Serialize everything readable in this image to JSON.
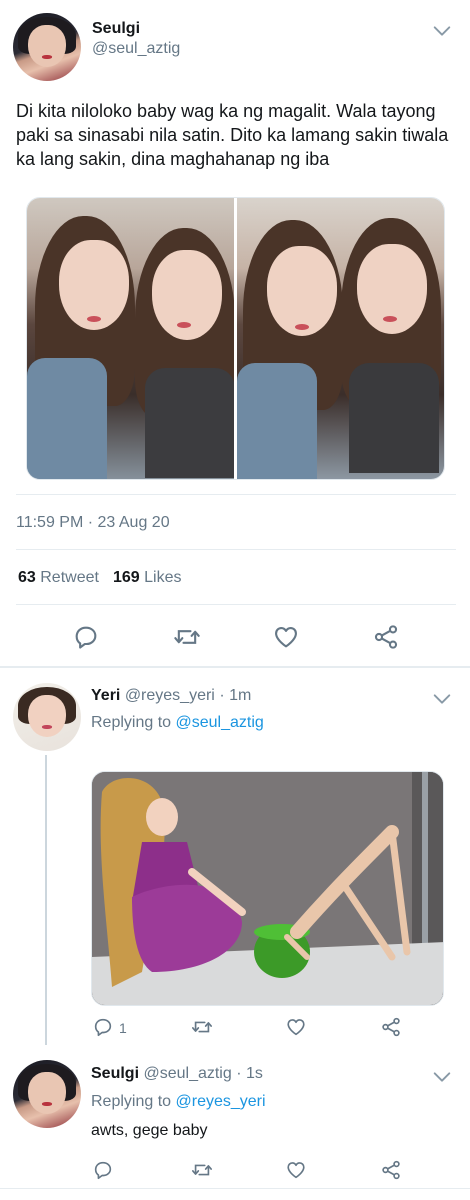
{
  "main_tweet": {
    "name": "Seulgi",
    "handle": "@seul_aztig",
    "text": "Di kita nilolоko baby wag ka ng magalit. Wala tayong paki sa sinasabi nila satin. Dito ka lamang sakin tiwala ka lang sakin, dina maghahanap ng iba",
    "timestamp": "11:59 PM · 23 Aug 20",
    "retweets": "63",
    "retweets_label": "Retweet",
    "likes": "169",
    "likes_label": "Likes",
    "icons": [
      "reply-icon",
      "retweet-icon",
      "like-icon",
      "share-icon"
    ]
  },
  "reply_1": {
    "name": "Yeri",
    "handle": "@reyes_yeri",
    "time": "· 1m",
    "replying_prefix": "Replying to",
    "replying_to": "@seul_aztig",
    "reply_count": "1"
  },
  "reply_2": {
    "name": "Seulgi",
    "handle": "@seul_aztig",
    "time": "· 1s",
    "replying_prefix": "Replying to",
    "replying_to": "@reyes_yeri",
    "text": "awts, gege baby"
  },
  "colors": {
    "text_primary": "#14171a",
    "text_secondary": "#657786",
    "link": "#1b95e0",
    "divider": "#e6ecf0"
  }
}
